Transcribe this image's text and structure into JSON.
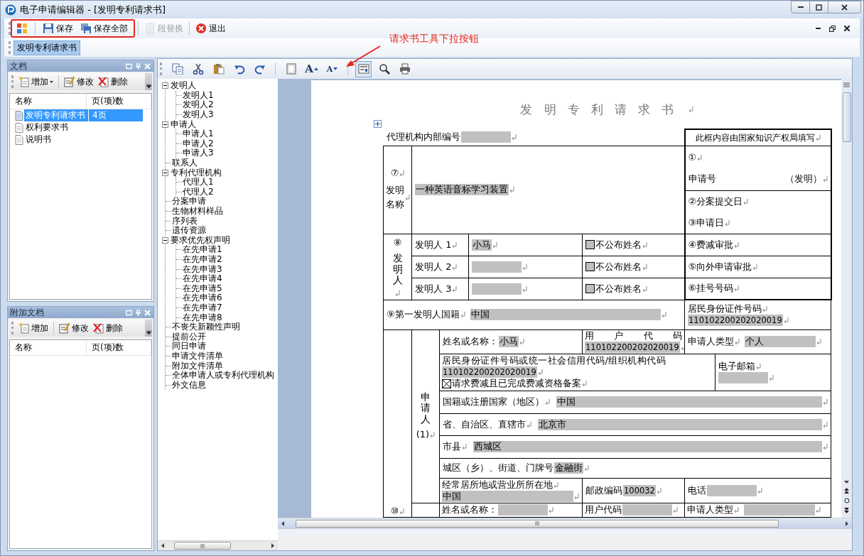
{
  "window": {
    "title": "电子申请编辑器 - [发明专利请求书]"
  },
  "toolbar": [
    {
      "kind": "layout",
      "separator_before": false,
      "disabled": false
    },
    {
      "kind": "save",
      "separator_before": true,
      "label": "保存",
      "disabled": false
    },
    {
      "kind": "save_all",
      "separator_before": false,
      "label": "保存全部",
      "disabled": false
    },
    {
      "kind": "replace",
      "separator_before": true,
      "label": "段替换",
      "disabled": true
    },
    {
      "kind": "exit",
      "separator_before": true,
      "label": "退出",
      "disabled": false
    }
  ],
  "document_tabs": [
    {
      "label": "发明专利请求书",
      "selected": true
    }
  ],
  "annotation": {
    "callout": "请求书工具下拉按钮"
  },
  "documents_panel": {
    "title": "文档",
    "actions": [
      {
        "kind": "add",
        "label": "增加",
        "dropdown": true
      },
      {
        "kind": "edit",
        "label": "修改",
        "dropdown": false
      },
      {
        "kind": "delete",
        "label": "删除",
        "dropdown": false
      }
    ],
    "columns": [
      "名称",
      "页(项)数"
    ],
    "rows": [
      {
        "name": "发明专利请求书",
        "pages": "4页",
        "selected": true
      },
      {
        "name": "权利要求书",
        "selected": false
      },
      {
        "name": "说明书",
        "selected": false
      }
    ]
  },
  "attachments_panel": {
    "title": "附加文档",
    "actions": [
      {
        "kind": "add",
        "label": "增加",
        "dropdown": false
      },
      {
        "kind": "edit",
        "label": "修改",
        "dropdown": false
      },
      {
        "kind": "delete",
        "label": "删除",
        "dropdown": false
      }
    ],
    "columns": [
      "名称",
      "页(项)数"
    ]
  },
  "editor_toolbar": [
    {
      "kind": "copy",
      "separator_before": false,
      "pressed": false
    },
    {
      "kind": "cut",
      "separator_before": false,
      "pressed": false
    },
    {
      "kind": "paste",
      "separator_before": false,
      "pressed": false
    },
    {
      "kind": "undo",
      "separator_before": false,
      "pressed": false
    },
    {
      "kind": "redo",
      "separator_before": false,
      "pressed": false
    },
    {
      "kind": "page",
      "separator_before": true,
      "pressed": false
    },
    {
      "kind": "font_up",
      "separator_before": false,
      "glyph": "A",
      "pressed": false
    },
    {
      "kind": "font_down",
      "separator_before": false,
      "glyph": "A",
      "pressed": false
    },
    {
      "kind": "form",
      "separator_before": true,
      "pressed": true
    },
    {
      "kind": "zoom",
      "separator_before": false,
      "pressed": false
    },
    {
      "kind": "print",
      "separator_before": false,
      "pressed": false
    }
  ],
  "outline": [
    {
      "label": "发明人",
      "expanded": true,
      "children": [
        {
          "label": "发明人1"
        },
        {
          "label": "发明人2"
        },
        {
          "label": "发明人3"
        }
      ]
    },
    {
      "label": "申请人",
      "expanded": true,
      "children": [
        {
          "label": "申请人1"
        },
        {
          "label": "申请人2"
        },
        {
          "label": "申请人3"
        }
      ]
    },
    {
      "label": "联系人"
    },
    {
      "label": "专利代理机构",
      "expanded": true,
      "children": [
        {
          "label": "代理人1"
        },
        {
          "label": "代理人2"
        }
      ]
    },
    {
      "label": "分案申请"
    },
    {
      "label": "生物材料样品"
    },
    {
      "label": "序列表"
    },
    {
      "label": "遗传资源"
    },
    {
      "label": "要求优先权声明",
      "expanded": true,
      "children": [
        {
          "label": "在先申请1"
        },
        {
          "label": "在先申请2"
        },
        {
          "label": "在先申请3"
        },
        {
          "label": "在先申请4"
        },
        {
          "label": "在先申请5"
        },
        {
          "label": "在先申请6"
        },
        {
          "label": "在先申请7"
        },
        {
          "label": "在先申请8"
        }
      ]
    },
    {
      "label": "不丧失新颖性声明"
    },
    {
      "label": "提前公开"
    },
    {
      "label": "同日申请"
    },
    {
      "label": "申请文件清单"
    },
    {
      "label": "附加文件清单"
    },
    {
      "label": "全体申请人或专利代理机构"
    },
    {
      "label": "外文信息"
    }
  ],
  "form": {
    "title": "发明专利请求书",
    "agency_no_label": "代理机构内部编号",
    "office": {
      "title": "此框内容由国家知识产权局填写",
      "app_no_mark": "①",
      "app_no_label": "申请号",
      "app_no_kind": "（发明）",
      "cells": [
        "②分案提交日",
        "③申请日",
        "④费减审批",
        "⑤向外申请审批",
        "⑥挂号号码"
      ]
    },
    "invention_name": {
      "no": "⑦",
      "label": "发明名称",
      "value": "一种英语音标学习装置"
    },
    "inventors": {
      "no": "⑧",
      "label": "发明人",
      "rows": [
        {
          "label": "发明人 1",
          "name": "小马",
          "withhold_label": "不公布姓名",
          "withhold": false
        },
        {
          "label": "发明人 2",
          "withhold_label": "不公布姓名",
          "withhold": false
        },
        {
          "label": "发明人 3",
          "withhold_label": "不公布姓名",
          "withhold": false
        }
      ]
    },
    "first_inventor": {
      "label": "⑨第一发明人国籍",
      "nationality": "中国",
      "id_label": "居民身份证件号码",
      "id_value": "110102200202020019"
    },
    "applicants": [
      {
        "label": "申请人",
        "index": "(1)",
        "name_label": "姓名或名称：",
        "name": "小马",
        "user_code_label": "用 户 代 码",
        "user_code": "110102200202020019",
        "type_label": "申请人类型",
        "type": "个人",
        "id_label": "居民身份证件号码或统一社会信用代码/组织机构代码",
        "id_value": "110102200202020019",
        "fee_label": "请求费减且已完成费减资格备案",
        "fee_reduction": true,
        "email_label": "电子邮箱",
        "country_label": "国籍或注册国家（地区）",
        "country": "中国",
        "province_label": "省、自治区、直辖市",
        "province": "北京市",
        "city_label": "市县",
        "city": "西城区",
        "street_label": "城区（乡）、街道、门牌号",
        "street": "金融街",
        "residence_label": "经常居所地或营业所所在地",
        "residence": "中国",
        "postcode_label": "邮政编码",
        "postcode": "100032",
        "phone_label": "电话"
      },
      {
        "no": "⑩",
        "name_label": "姓名或名称：",
        "user_code_label": "用户代码",
        "type_label": "申请人类型"
      }
    ]
  }
}
